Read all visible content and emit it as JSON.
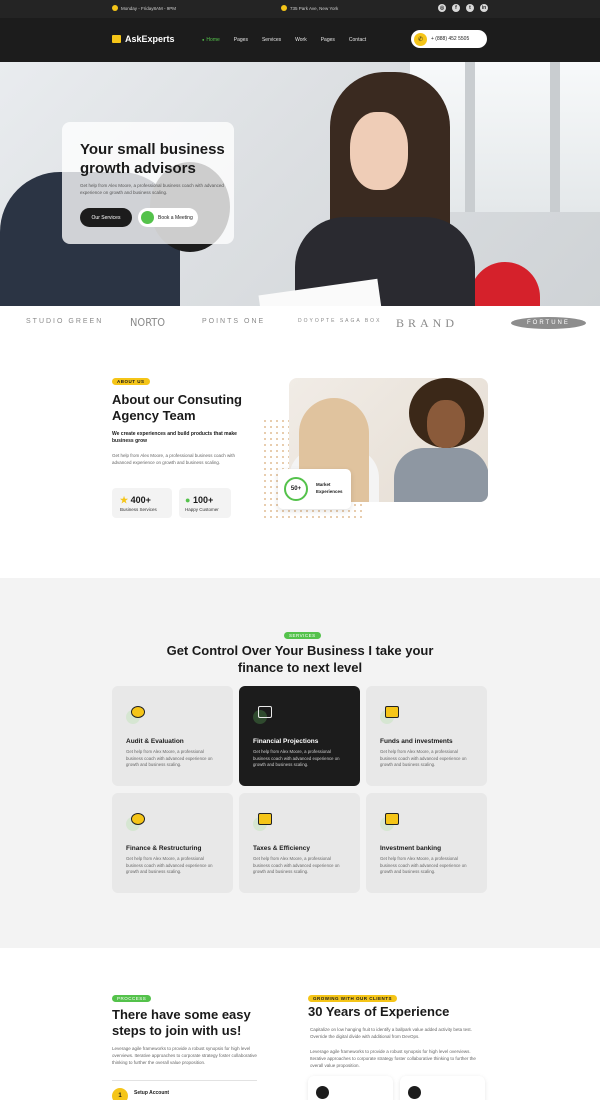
{
  "topbar": {
    "hours": "Monday - Friday8AM - 9PM",
    "address": "735 Park Ave, New York",
    "social": [
      "instagram-icon",
      "facebook-icon",
      "twitter-icon",
      "linkedin-icon"
    ]
  },
  "nav": {
    "logo": "AskExperts",
    "items": [
      "Home",
      "Pages",
      "Services",
      "Work",
      "Pages",
      "Contact"
    ],
    "phone": "+ (888) 452 5505"
  },
  "hero": {
    "title": "Your small business growth advisors",
    "desc": "Get help from Alex Moore, a professional business coach with advanced experience on growth and business scaling.",
    "btn_services": "Our Services",
    "btn_meeting": "Book a Meeting"
  },
  "brands": [
    "STUDIO GREEN",
    "NORTO",
    "POINTS ONE",
    "DOYOPTE SAGA BOX",
    "BRAND",
    "FORTUNE"
  ],
  "about": {
    "tag": "ABOUT US",
    "title": "About our Consuting Agency Team",
    "sub": "We create experiences and build products that make business grow",
    "desc": "Get help from Alex Moore, a professional business coach with advanced experience on growth and business scaling.",
    "stat1_num": "400+",
    "stat1_label": "Business Services",
    "stat2_num": "100+",
    "stat2_label": "Happy Customer",
    "exp_num": "50+",
    "exp_label": "Market Experiences"
  },
  "services": {
    "tag": "SERVICES",
    "title": "Get Control Over Your Business I take your finance to next level",
    "desc": "Get help from Alex Moore, a professional business coach with advanced experience on growth and business scaling.",
    "cards": [
      {
        "title": "Audit & Evaluation"
      },
      {
        "title": "Financial Projections"
      },
      {
        "title": "Funds and investments"
      },
      {
        "title": "Finance & Restructuring"
      },
      {
        "title": "Taxes & Efficiency"
      },
      {
        "title": "Investment banking"
      }
    ]
  },
  "process": {
    "tag": "PROCCESS",
    "title": "There have some easy steps to join with us!",
    "desc": "Leverage agile frameworks to provide a robust synopsis for high level overviews. Iterative approaches to corporate strategy foster collaborative thinking to further the overall value proposition.",
    "step1_num": "1",
    "step1_label": "Setup Account"
  },
  "growing": {
    "tag": "GROWING WITH OUR CLIENTS",
    "title": "30 Years of Experience",
    "p1": "Capitalize on low hanging fruit to identify a ballpark value added activity beta test. Override the digital divide with additional from DevOps.",
    "p2": "Leverage agile frameworks to provide a robust synopsis for high level overviews. Iterative approaches to corporate strategy foster collaborative thinking to further the overall value proposition."
  },
  "colors": {
    "accent_yellow": "#f5c518",
    "accent_green": "#54c24b",
    "dark": "#1c1c1c"
  }
}
